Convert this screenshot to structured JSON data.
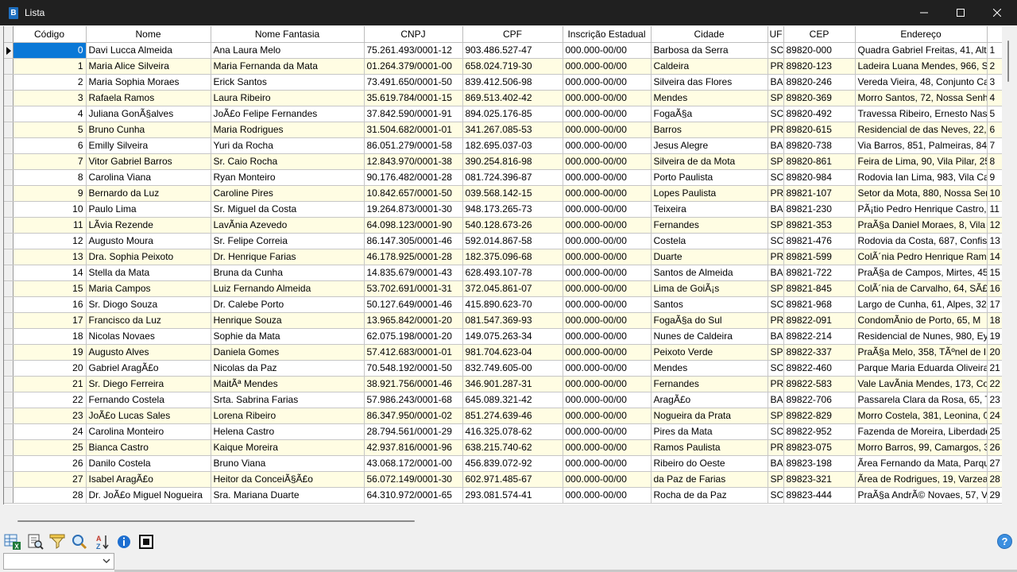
{
  "window": {
    "title": "Lista",
    "app_icon_letter": "B"
  },
  "table": {
    "columns": [
      "Código",
      "Nome",
      "Nome Fantasia",
      "CNPJ",
      "CPF",
      "Inscrição Estadual",
      "Cidade",
      "UF",
      "CEP",
      "Endereço",
      ""
    ],
    "selected_row": 0,
    "rows": [
      [
        "0",
        "Davi Lucca Almeida",
        "Ana Laura Melo",
        "75.261.493/0001-12",
        "903.486.527-47",
        "000.000-00/00",
        "Barbosa da Serra",
        "SC",
        "89820-000",
        "Quadra Gabriel Freitas, 41, Altc",
        "1"
      ],
      [
        "1",
        "Maria Alice Silveira",
        "Maria Fernanda da Mata",
        "01.264.379/0001-00",
        "658.024.719-30",
        "000.000-00/00",
        "Caldeira",
        "PR",
        "89820-123",
        "Ladeira Luana Mendes, 966, SÃ",
        "2"
      ],
      [
        "2",
        "Maria Sophia Moraes",
        "Erick Santos",
        "73.491.650/0001-50",
        "839.412.506-98",
        "000.000-00/00",
        "Silveira das Flores",
        "BA",
        "89820-246",
        "Vereda Vieira, 48, Conjunto Cal",
        "3"
      ],
      [
        "3",
        "Rafaela Ramos",
        "Laura Ribeiro",
        "35.619.784/0001-15",
        "869.513.402-42",
        "000.000-00/00",
        "Mendes",
        "SP",
        "89820-369",
        "Morro Santos, 72, Nossa Senho",
        "4"
      ],
      [
        "4",
        "Juliana GonÃ§alves",
        "JoÃ£o Felipe Fernandes",
        "37.842.590/0001-91",
        "894.025.176-85",
        "000.000-00/00",
        "FogaÃ§a",
        "SC",
        "89820-492",
        "Travessa Ribeiro, Ernesto Nasci",
        "5"
      ],
      [
        "5",
        "Bruno Cunha",
        "Maria Rodrigues",
        "31.504.682/0001-01",
        "341.267.085-53",
        "000.000-00/00",
        "Barros",
        "PR",
        "89820-615",
        "Residencial de das Neves, 22, V",
        "6"
      ],
      [
        "6",
        "Emilly Silveira",
        "Yuri da Rocha",
        "86.051.279/0001-58",
        "182.695.037-03",
        "000.000-00/00",
        "Jesus Alegre",
        "BA",
        "89820-738",
        "Via Barros, 851, Palmeiras, 843",
        "7"
      ],
      [
        "7",
        "Vitor Gabriel Barros",
        "Sr. Caio Rocha",
        "12.843.970/0001-38",
        "390.254.816-98",
        "000.000-00/00",
        "Silveira de da Mota",
        "SP",
        "89820-861",
        "Feira de Lima, 90, Vila Pilar, 25",
        "8"
      ],
      [
        "8",
        "Carolina Viana",
        "Ryan Monteiro",
        "90.176.482/0001-28",
        "081.724.396-87",
        "000.000-00/00",
        "Porto Paulista",
        "SC",
        "89820-984",
        "Rodovia Ian Lima, 983, Vila Car",
        "9"
      ],
      [
        "9",
        "Bernardo da Luz",
        "Caroline Pires",
        "10.842.657/0001-50",
        "039.568.142-15",
        "000.000-00/00",
        "Lopes Paulista",
        "PR",
        "89821-107",
        "Setor da Mota, 880, Nossa Senl",
        "10"
      ],
      [
        "10",
        "Paulo Lima",
        "Sr. Miguel da Costa",
        "19.264.873/0001-30",
        "948.173.265-73",
        "000.000-00/00",
        "Teixeira",
        "BA",
        "89821-230",
        "PÃ¡tio Pedro Henrique Castro,",
        "11"
      ],
      [
        "11",
        "LÃ­via Rezende",
        "LavÃ­nia Azevedo",
        "64.098.123/0001-90",
        "540.128.673-26",
        "000.000-00/00",
        "Fernandes",
        "SP",
        "89821-353",
        "PraÃ§a Daniel Moraes, 8, Vila N",
        "12"
      ],
      [
        "12",
        "Augusto Moura",
        "Sr. Felipe Correia",
        "86.147.305/0001-46",
        "592.014.867-58",
        "000.000-00/00",
        "Costela",
        "SC",
        "89821-476",
        "Rodovia da Costa, 687, Confisc",
        "13"
      ],
      [
        "13",
        "Dra. Sophia Peixoto",
        "Dr. Henrique Farias",
        "46.178.925/0001-28",
        "182.375.096-68",
        "000.000-00/00",
        "Duarte",
        "PR",
        "89821-599",
        "ColÃ´nia Pedro Henrique Ram",
        "14"
      ],
      [
        "14",
        "Stella da Mata",
        "Bruna da Cunha",
        "14.835.679/0001-43",
        "628.493.107-78",
        "000.000-00/00",
        "Santos de Almeida",
        "BA",
        "89821-722",
        "PraÃ§a de Campos, Mirtes, 451",
        "15"
      ],
      [
        "15",
        "Maria Campos",
        "Luiz Fernando Almeida",
        "53.702.691/0001-31",
        "372.045.861-07",
        "000.000-00/00",
        "Lima de GoiÃ¡s",
        "SP",
        "89821-845",
        "ColÃ´nia de Carvalho, 64, SÃ£c",
        "16"
      ],
      [
        "16",
        "Sr. Diogo Souza",
        "Dr. Calebe Porto",
        "50.127.649/0001-46",
        "415.890.623-70",
        "000.000-00/00",
        "Santos",
        "SC",
        "89821-968",
        "Largo de Cunha, 61, Alpes, 324",
        "17"
      ],
      [
        "17",
        "Francisco da Luz",
        "Henrique Souza",
        "13.965.842/0001-20",
        "081.547.369-93",
        "000.000-00/00",
        "FogaÃ§a do Sul",
        "PR",
        "89822-091",
        "CondomÃ­nio de Porto, 65, M",
        "18"
      ],
      [
        "18",
        "Nicolas Novaes",
        "Sophie da Mata",
        "62.075.198/0001-20",
        "149.075.263-34",
        "000.000-00/00",
        "Nunes de Caldeira",
        "BA",
        "89822-214",
        "Residencial de Nunes, 980, Eyn",
        "19"
      ],
      [
        "19",
        "Augusto Alves",
        "Daniela Gomes",
        "57.412.683/0001-01",
        "981.704.623-04",
        "000.000-00/00",
        "Peixoto Verde",
        "SP",
        "89822-337",
        "PraÃ§a Melo, 358, TÃºnel de Ib",
        "20"
      ],
      [
        "20",
        "Gabriel AragÃ£o",
        "Nicolas da Paz",
        "70.548.192/0001-50",
        "832.749.605-00",
        "000.000-00/00",
        "Mendes",
        "SC",
        "89822-460",
        "Parque Maria Eduarda Oliveira,",
        "21"
      ],
      [
        "21",
        "Sr. Diego Ferreira",
        "MaitÃª Mendes",
        "38.921.756/0001-46",
        "346.901.287-31",
        "000.000-00/00",
        "Fernandes",
        "PR",
        "89822-583",
        "Vale LavÃ­nia Mendes, 173, Co",
        "22"
      ],
      [
        "22",
        "Fernando Costela",
        "Srta. Sabrina Farias",
        "57.986.243/0001-68",
        "645.089.321-42",
        "000.000-00/00",
        "AragÃ£o",
        "BA",
        "89822-706",
        "Passarela Clara da Rosa, 65, Tir",
        "23"
      ],
      [
        "23",
        "JoÃ£o Lucas Sales",
        "Lorena Ribeiro",
        "86.347.950/0001-02",
        "851.274.639-46",
        "000.000-00/00",
        "Nogueira da Prata",
        "SP",
        "89822-829",
        "Morro Costela, 381, Leonina, 0",
        "24"
      ],
      [
        "24",
        "Carolina Monteiro",
        "Helena Castro",
        "28.794.561/0001-29",
        "416.325.078-62",
        "000.000-00/00",
        "Pires da Mata",
        "SC",
        "89822-952",
        "Fazenda de Moreira, Liberdade",
        "25"
      ],
      [
        "25",
        "Bianca Castro",
        "Kaique Moreira",
        "42.937.816/0001-96",
        "638.215.740-62",
        "000.000-00/00",
        "Ramos Paulista",
        "PR",
        "89823-075",
        "Morro Barros, 99, Camargos, 3",
        "26"
      ],
      [
        "26",
        "Danilo Costela",
        "Bruno Viana",
        "43.068.172/0001-00",
        "456.839.072-92",
        "000.000-00/00",
        "Ribeiro do Oeste",
        "BA",
        "89823-198",
        "Ãrea Fernando da Mata, Parqu",
        "27"
      ],
      [
        "27",
        "Isabel AragÃ£o",
        "Heitor da ConceiÃ§Ã£o",
        "56.072.149/0001-30",
        "602.971.485-67",
        "000.000-00/00",
        "da Paz de Farias",
        "SP",
        "89823-321",
        "Ãrea de Rodrigues, 19, Varzea",
        "28"
      ],
      [
        "28",
        "Dr. JoÃ£o Miguel Nogueira",
        "Sra. Mariana Duarte",
        "64.310.972/0001-65",
        "293.081.574-41",
        "000.000-00/00",
        "Rocha de da Paz",
        "SC",
        "89823-444",
        "PraÃ§a AndrÃ© Novaes, 57, Vi",
        "29"
      ]
    ]
  },
  "toolbar": {
    "buttons": [
      {
        "name": "export-excel-icon"
      },
      {
        "name": "print-preview-icon"
      },
      {
        "name": "filter-icon"
      },
      {
        "name": "search-icon"
      },
      {
        "name": "sort-az-icon"
      },
      {
        "name": "info-icon"
      },
      {
        "name": "select-icon"
      }
    ],
    "help_label": "?"
  },
  "dropdown": {
    "value": ""
  },
  "colors": {
    "titlebar": "#202020",
    "selection": "#0a78d7",
    "odd_row": "#fffde3",
    "even_row": "#ffffff"
  }
}
